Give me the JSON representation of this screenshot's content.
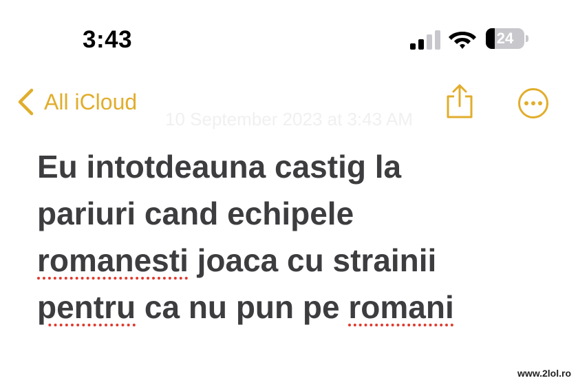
{
  "status_bar": {
    "time": "3:43",
    "battery_level": "24",
    "signal_bars_active": 2,
    "signal_bars_total": 4
  },
  "nav": {
    "back_label": "All iCloud",
    "accent_color": "#e1ad2b"
  },
  "note": {
    "date": "10 September 2023 at 3:43 AM",
    "lines": [
      {
        "segments": [
          {
            "text": "Eu intotdeauna castig la",
            "misspelled": false
          }
        ]
      },
      {
        "segments": [
          {
            "text": "pariuri cand echipele",
            "misspelled": false
          }
        ]
      },
      {
        "segments": [
          {
            "text": "romanesti",
            "misspelled": true
          },
          {
            "text": " joaca cu strainii",
            "misspelled": false
          }
        ]
      },
      {
        "segments": [
          {
            "text": "pentru",
            "misspelled": true
          },
          {
            "text": " ca nu pun pe ",
            "misspelled": false
          },
          {
            "text": "romani",
            "misspelled": true
          }
        ]
      }
    ],
    "misspelling_underline_color": "#e0392e"
  },
  "watermark": "www.2lol.ro",
  "icons": [
    "signal-icon",
    "wifi-icon",
    "battery-icon",
    "chevron-left-icon",
    "share-icon",
    "more-icon"
  ]
}
